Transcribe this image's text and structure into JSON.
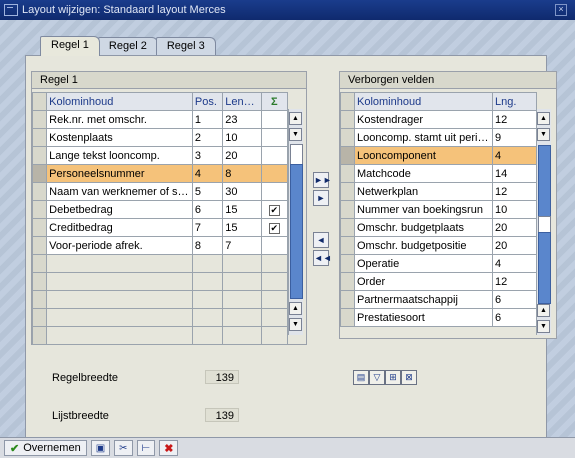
{
  "window": {
    "title": "Layout wijzigen: Standaard layout Merces"
  },
  "tabs": [
    "Regel 1",
    "Regel 2",
    "Regel 3"
  ],
  "left": {
    "title": "Regel 1",
    "headers": {
      "col": "Kolominhoud",
      "pos": "Pos.",
      "len": "Leng..."
    },
    "rows": [
      {
        "name": "Rek.nr. met omschr.",
        "pos": "1",
        "len": "23",
        "sum": false
      },
      {
        "name": "Kostenplaats",
        "pos": "2",
        "len": "10",
        "sum": false
      },
      {
        "name": "Lange tekst looncomp.",
        "pos": "3",
        "len": "20",
        "sum": false
      },
      {
        "name": "Personeelsnummer",
        "pos": "4",
        "len": "8",
        "sum": false
      },
      {
        "name": "Naam van werknemer of sollicitant",
        "pos": "5",
        "len": "30",
        "sum": false
      },
      {
        "name": "Debetbedrag",
        "pos": "6",
        "len": "15",
        "sum": true
      },
      {
        "name": "Creditbedrag",
        "pos": "7",
        "len": "15",
        "sum": true
      },
      {
        "name": "Voor-periode afrek.",
        "pos": "8",
        "len": "7",
        "sum": false
      }
    ],
    "highlight_index": 3
  },
  "right": {
    "title": "Verborgen velden",
    "headers": {
      "col": "Kolominhoud",
      "len": "Lng."
    },
    "rows": [
      {
        "name": "Kostendrager",
        "len": "12"
      },
      {
        "name": "Looncomp. stamt uit periode",
        "len": "9"
      },
      {
        "name": "Looncomponent",
        "len": "4"
      },
      {
        "name": "Matchcode",
        "len": "14"
      },
      {
        "name": "Netwerkplan",
        "len": "12"
      },
      {
        "name": "Nummer van boekingsrun",
        "len": "10"
      },
      {
        "name": "Omschr. budgetplaats",
        "len": "20"
      },
      {
        "name": "Omschr. budgetpositie",
        "len": "20"
      },
      {
        "name": "Operatie",
        "len": "4"
      },
      {
        "name": "Order",
        "len": "12"
      },
      {
        "name": "Partnermaatschappij",
        "len": "6"
      },
      {
        "name": "Prestatiesoort",
        "len": "6"
      }
    ],
    "highlight_index": 2
  },
  "footer": {
    "regelbreedte_label": "Regelbreedte",
    "regelbreedte_value": "139",
    "lijstbreedte_label": "Lijstbreedte",
    "lijstbreedte_value": "139"
  },
  "bottom": {
    "ok_label": "Overnemen"
  },
  "colors": {
    "titlebar": "#0f2a6e",
    "highlight": "#f5c27a",
    "header_text": "#1d3a8a"
  }
}
